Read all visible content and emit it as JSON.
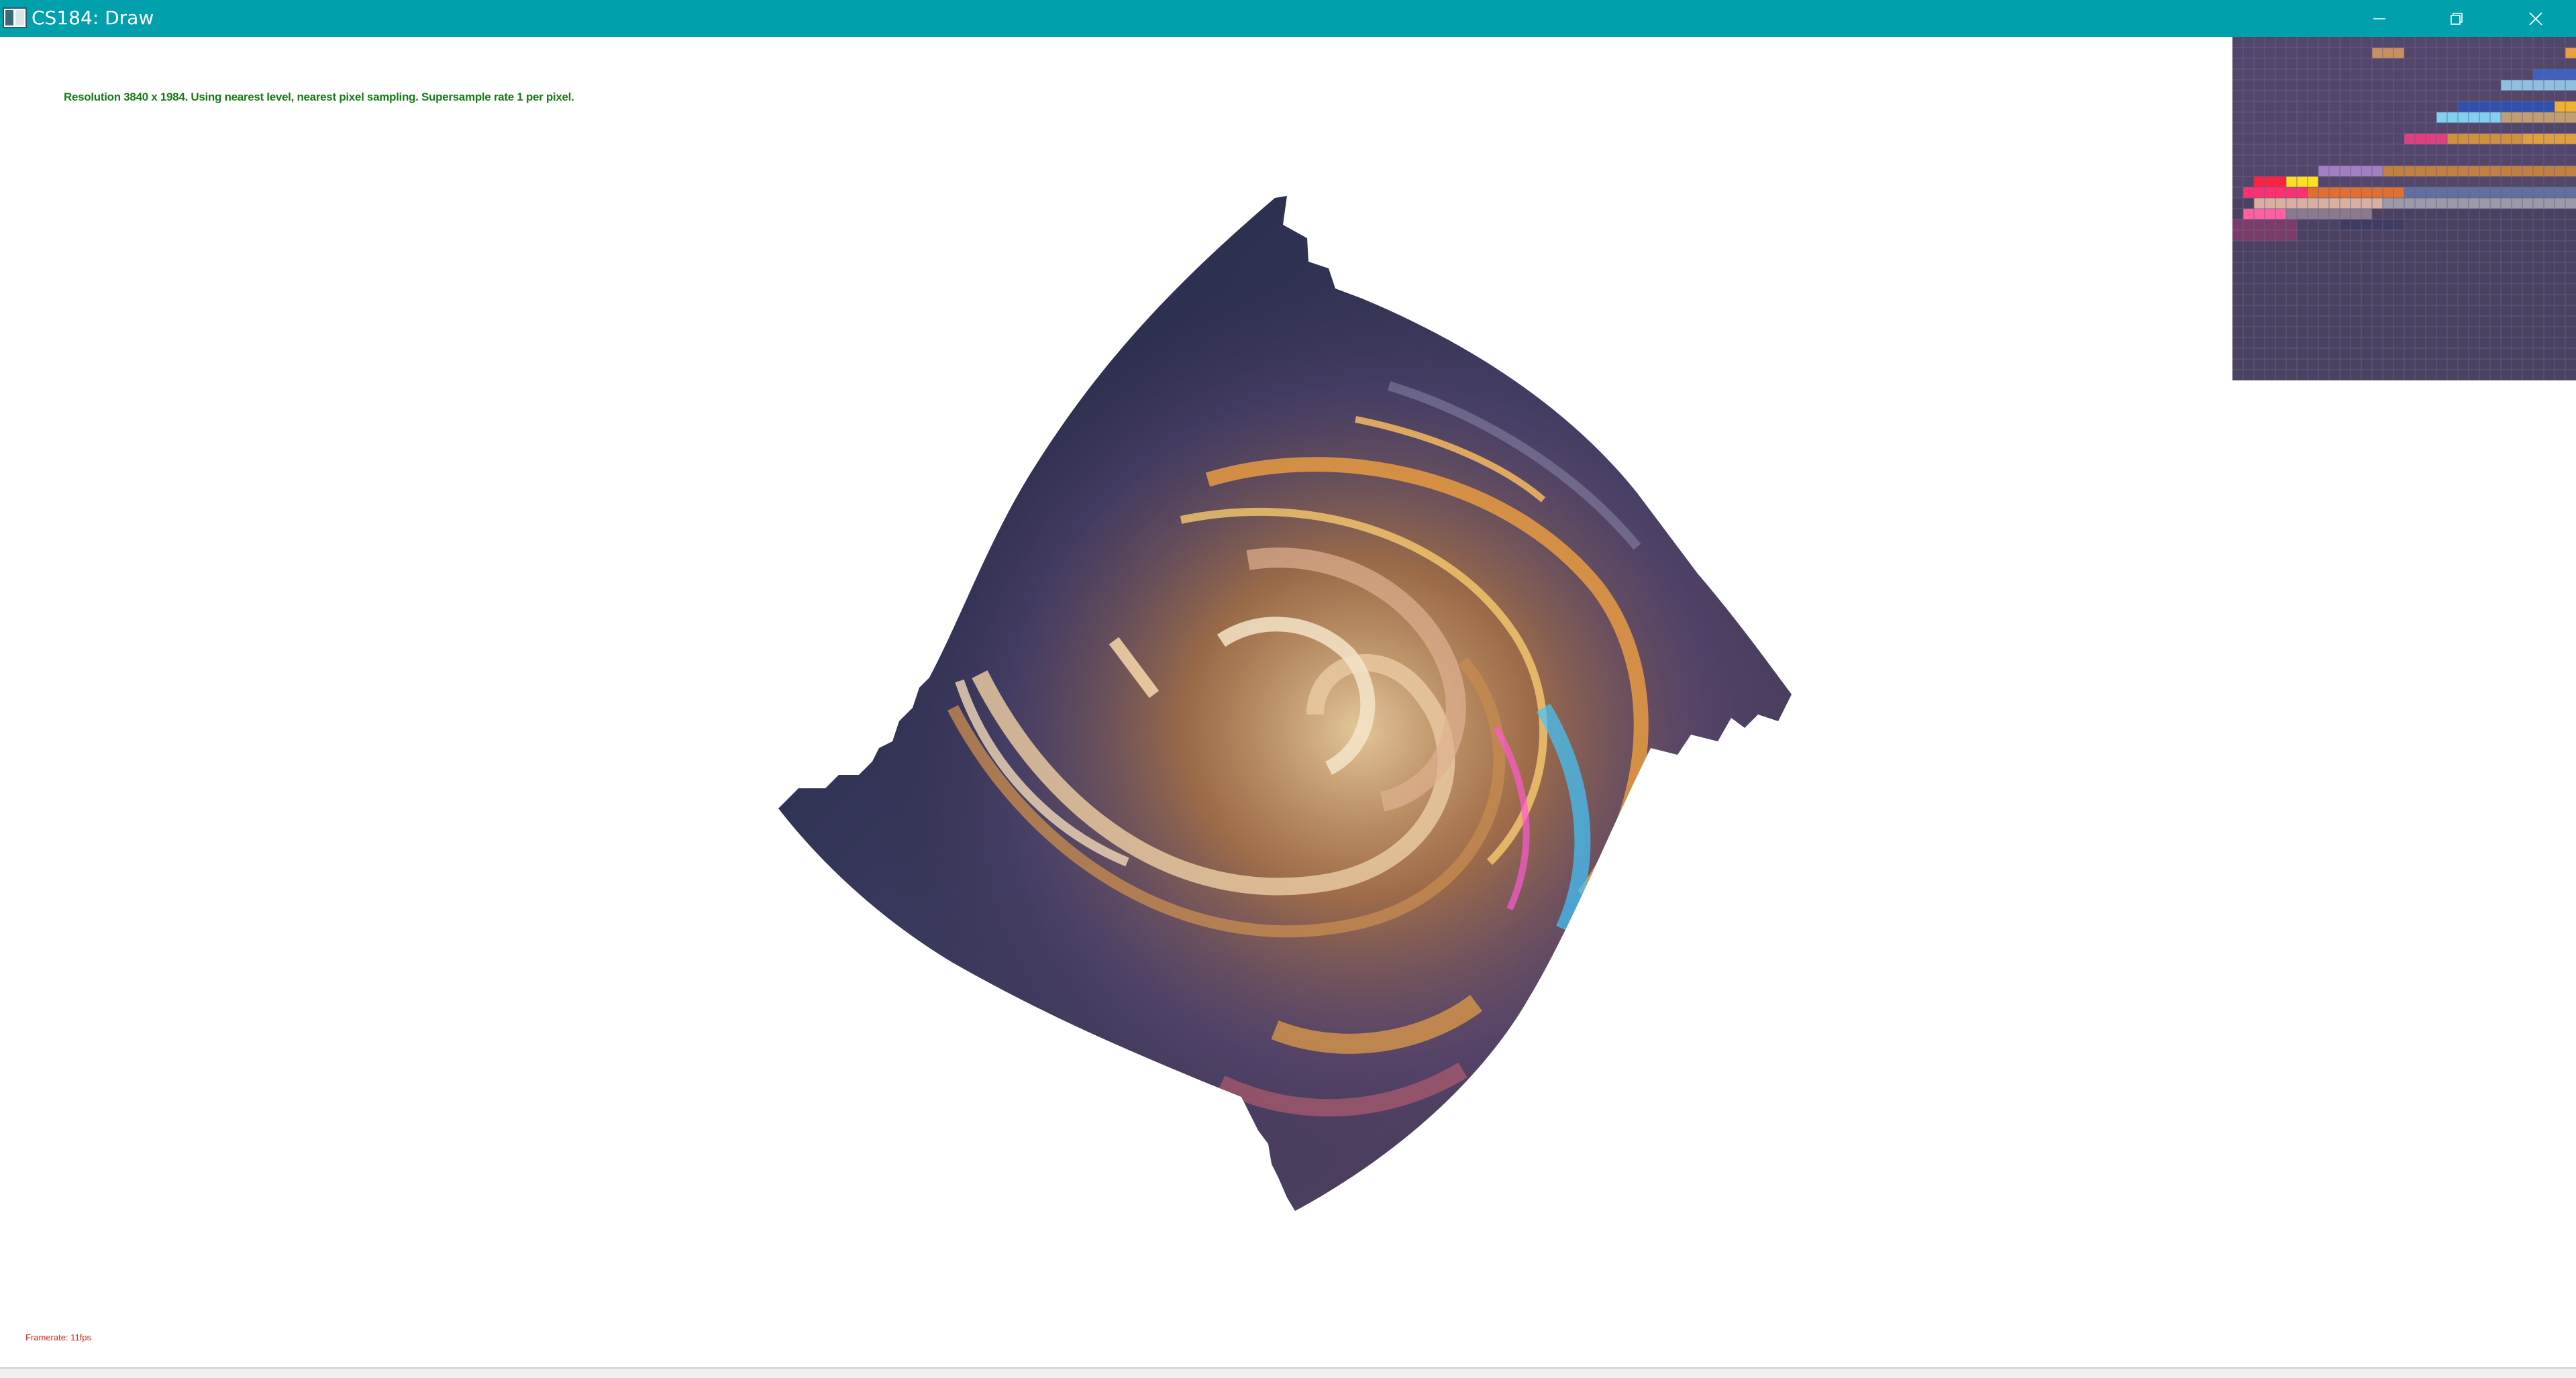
{
  "window": {
    "title": "CS184: Draw",
    "controls": {
      "minimize_icon": "minimize-icon",
      "maximize_icon": "restore-icon",
      "close_icon": "close-icon"
    },
    "titlebar_color": "#00a0ad"
  },
  "canvas": {
    "status": "Resolution 3840 x 1984. Using nearest level, nearest pixel sampling. Supersample rate 1 per pixel.",
    "framerate": "Framerate: 11fps",
    "status_color": "#1a7a1a",
    "framerate_color": "#e02020"
  },
  "zoom_panel": {
    "description_icon": "pixel-zoom-inspector"
  }
}
